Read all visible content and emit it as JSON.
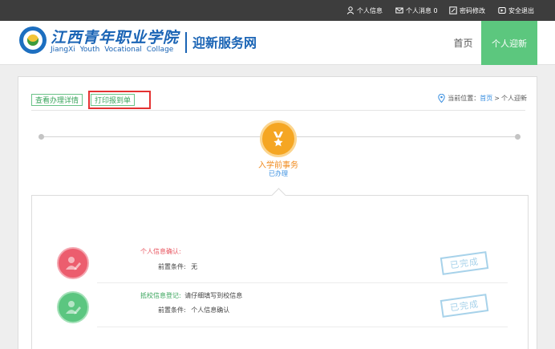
{
  "topbar": {
    "links": [
      {
        "label": "个人信息",
        "icon": "user-icon"
      },
      {
        "label": "个人消息 0",
        "icon": "envelope-icon"
      },
      {
        "label": "密码修改",
        "icon": "edit-icon"
      },
      {
        "label": "安全退出",
        "icon": "logout-icon"
      }
    ]
  },
  "header": {
    "logo_cn": "江西青年职业学院",
    "logo_en": "JiangXi Youth Vocational Collage",
    "site_name": "迎新服务网",
    "nav": {
      "home": "首页",
      "active": "个人迎新"
    }
  },
  "toolbar": {
    "detail_label": "查看办理详情",
    "print_label": "打印报到单"
  },
  "breadcrumb": {
    "prefix": "当前位置：",
    "home": "首页",
    "separator": ">",
    "current": "个人迎新"
  },
  "step": {
    "title": "入学前事务",
    "status": "已办理",
    "icon": "medal-icon"
  },
  "tasks": [
    {
      "title": "个人信息确认:",
      "title_color": "#e8545f",
      "condition_label": "前置条件:",
      "condition_value": "无",
      "stamp": "已完成"
    },
    {
      "title": "抵校信息登记:",
      "title_color": "#3aa55c",
      "note": "请仔细填写到校信息",
      "condition_label": "前置条件:",
      "condition_value": "个人信息确认",
      "stamp": "已完成"
    }
  ],
  "colors": {
    "accent_green": "#5cc77e",
    "brand_blue": "#1a64b5",
    "step_orange": "#f5a623",
    "highlight_red": "#e43232"
  }
}
